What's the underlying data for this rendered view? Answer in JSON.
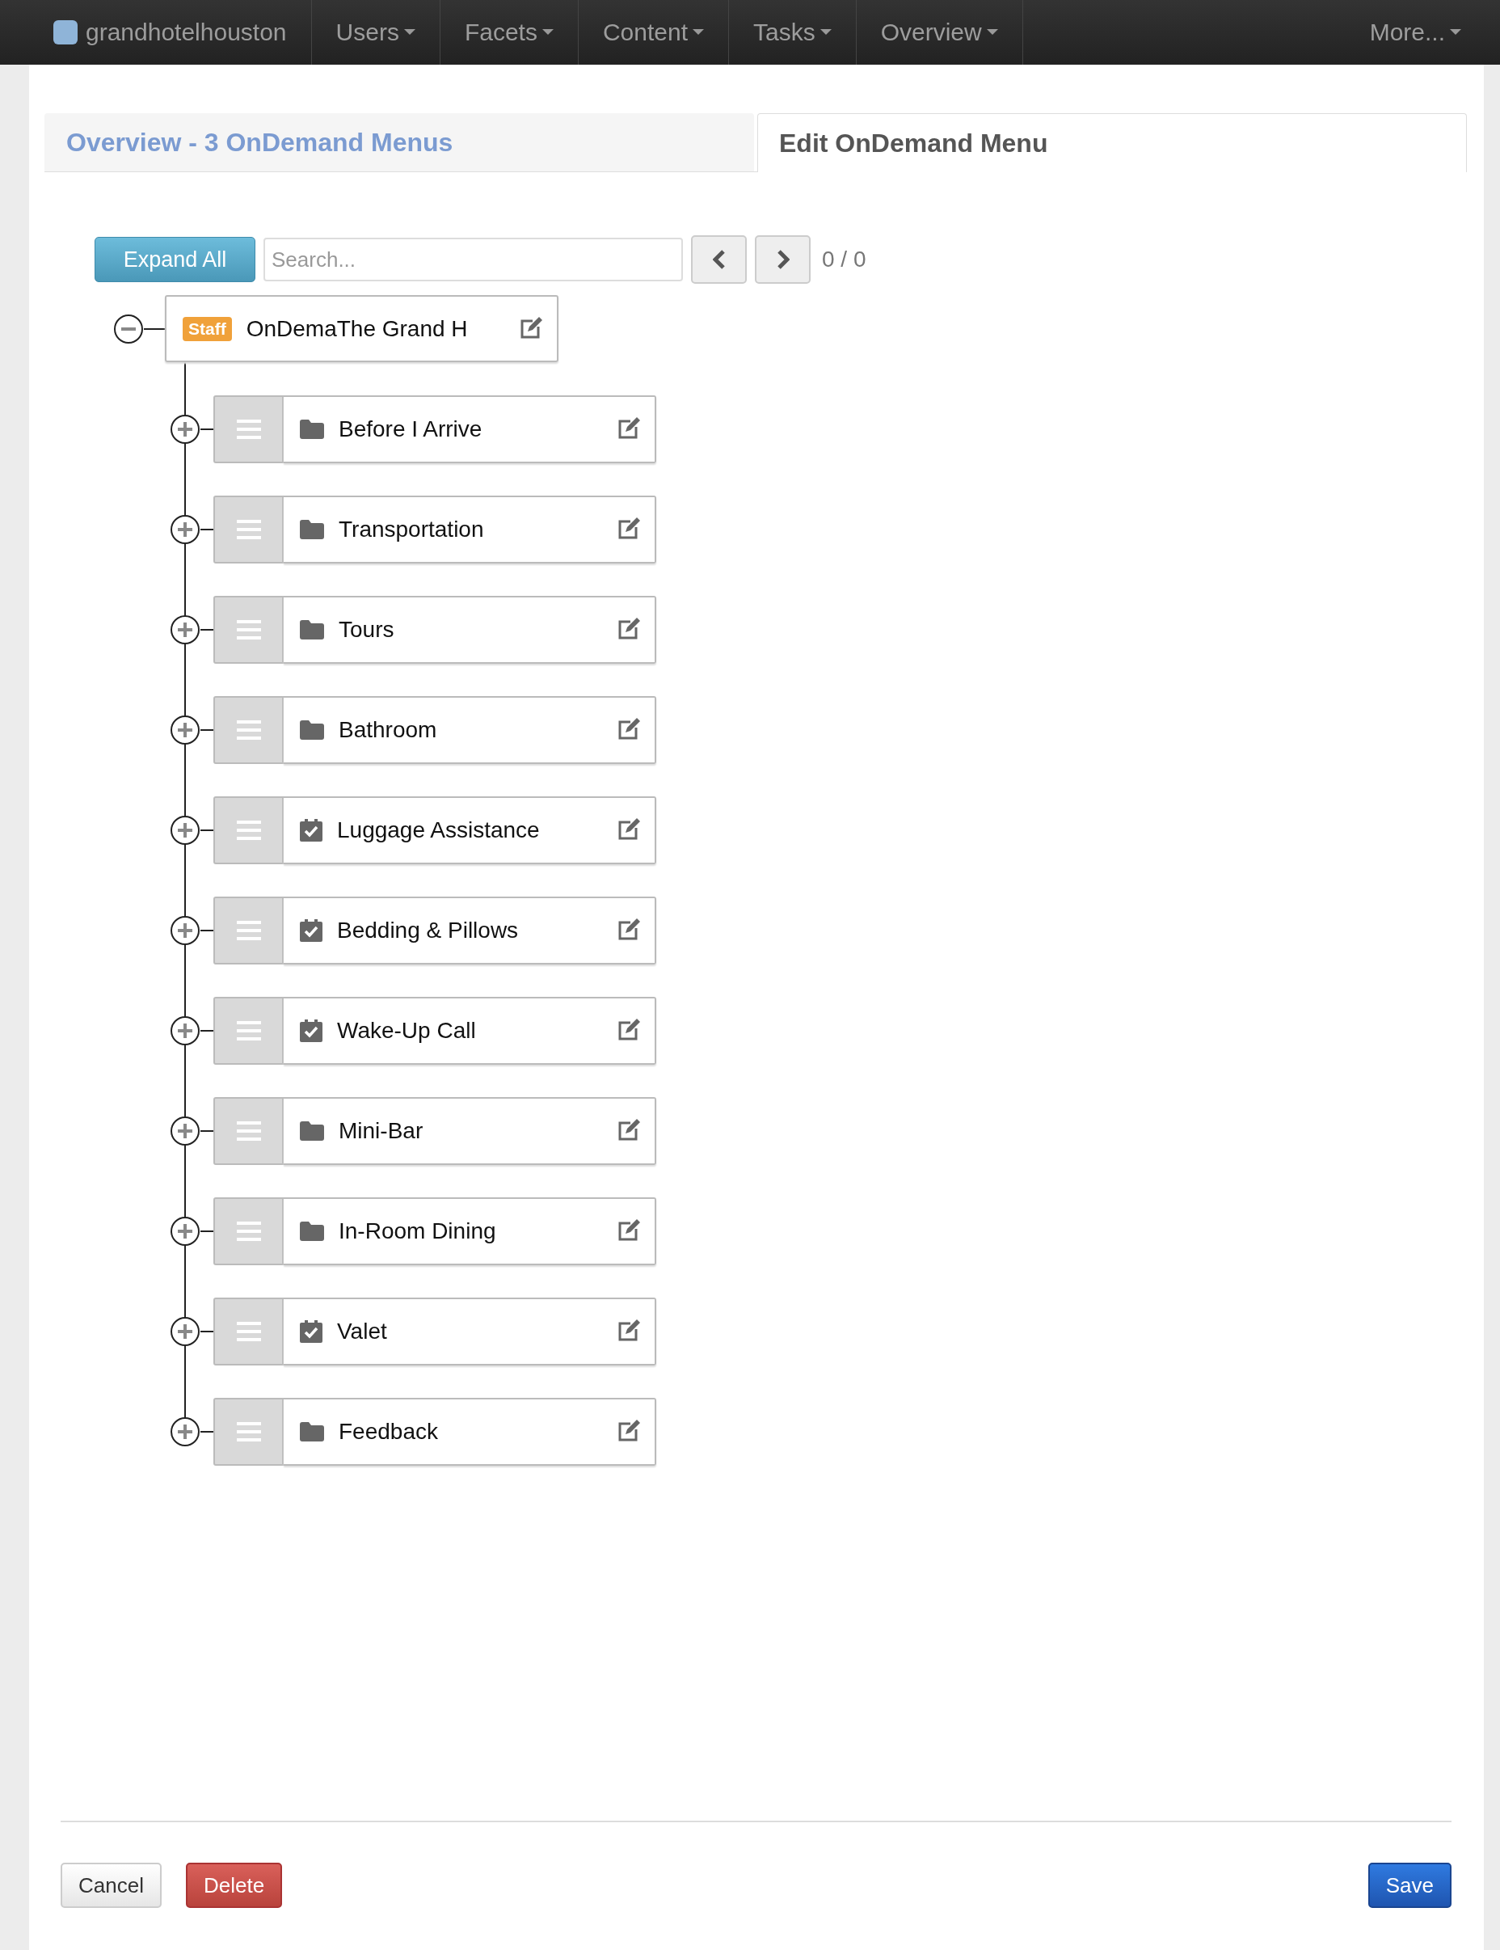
{
  "navbar": {
    "brand": "grandhotelhouston",
    "menus": [
      {
        "label": "Users"
      },
      {
        "label": "Facets"
      },
      {
        "label": "Content"
      },
      {
        "label": "Tasks"
      },
      {
        "label": "Overview"
      }
    ],
    "more": "More..."
  },
  "tabs": [
    {
      "label": "Overview - 3 OnDemand Menus",
      "selected": false
    },
    {
      "label": "Edit OnDemand Menu",
      "selected": true
    }
  ],
  "toolbar": {
    "expand_button": "Expand All",
    "search": {
      "placeholder": "Search..."
    },
    "counter": "0 / 0"
  },
  "tree": {
    "badge": "Staff",
    "label": "OnDemaThe Grand H",
    "expanded": true,
    "children": [
      {
        "label": "Before I Arrive",
        "kind": "folder",
        "expanded": false
      },
      {
        "label": "Transportation",
        "kind": "folder",
        "expanded": false
      },
      {
        "label": "Tours",
        "kind": "folder",
        "expanded": false
      },
      {
        "label": "Bathroom",
        "kind": "folder",
        "expanded": false
      },
      {
        "label": "Luggage Assistance",
        "kind": "task",
        "expanded": false
      },
      {
        "label": "Bedding & Pillows",
        "kind": "task",
        "expanded": false
      },
      {
        "label": "Wake-Up Call",
        "kind": "task",
        "expanded": false
      },
      {
        "label": "Mini-Bar",
        "kind": "folder",
        "expanded": false
      },
      {
        "label": "In-Room Dining",
        "kind": "folder",
        "expanded": false
      },
      {
        "label": "Valet",
        "kind": "task",
        "expanded": false
      },
      {
        "label": "Feedback",
        "kind": "folder",
        "expanded": false
      }
    ]
  },
  "footer": {
    "buttons": [
      {
        "label": "Cancel",
        "kind": "default"
      },
      {
        "label": "Delete",
        "kind": "danger"
      },
      {
        "label": "Save",
        "kind": "primary"
      }
    ]
  }
}
